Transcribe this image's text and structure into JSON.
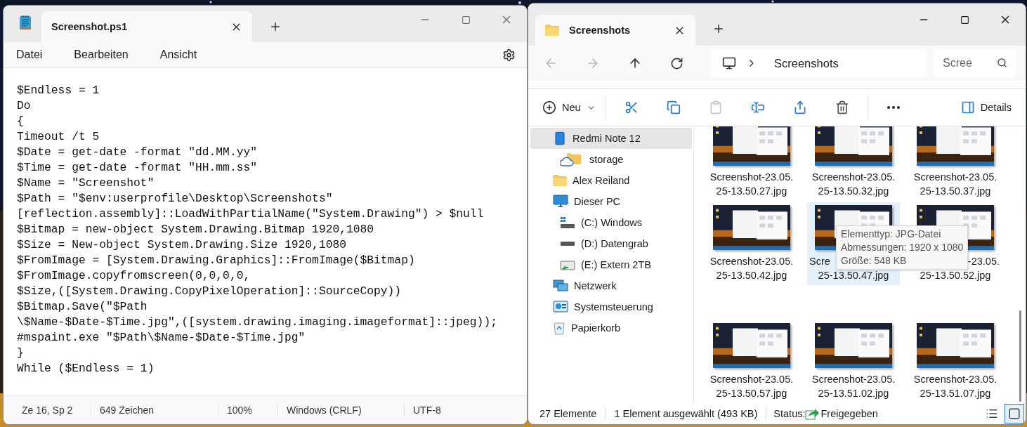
{
  "notepad": {
    "tab_title": "Screenshot.ps1",
    "menu": [
      "Datei",
      "Bearbeiten",
      "Ansicht"
    ],
    "code_lines": [
      "$Endless = 1",
      "Do",
      "{",
      "Timeout /t 5",
      "$Date = get-date -format \"dd.MM.yy\"",
      "$Time = get-date -format \"HH.mm.ss\"",
      "$Name = \"Screenshot\"",
      "$Path = \"$env:userprofile\\Desktop\\Screenshots\"",
      "[reflection.assembly]::LoadWithPartialName(\"System.Drawing\") > $null",
      "$Bitmap = new-object System.Drawing.Bitmap 1920,1080",
      "$Size = New-object System.Drawing.Size 1920,1080",
      "$FromImage = [System.Drawing.Graphics]::FromImage($Bitmap)",
      "$FromImage.copyfromscreen(0,0,0,0,",
      "$Size,([System.Drawing.CopyPixelOperation]::SourceCopy))",
      "$Bitmap.Save(\"$Path",
      "\\$Name-$Date-$Time.jpg\",([system.drawing.imaging.imageformat]::jpeg));",
      "#mspaint.exe \"$Path\\$Name-$Date-$Time.jpg\"",
      "}",
      "While ($Endless = 1)"
    ],
    "status": [
      "Ze 16, Sp 2",
      "649 Zeichen",
      "100%",
      "Windows (CRLF)",
      "UTF-8"
    ]
  },
  "explorer": {
    "tab_title": "Screenshots",
    "nav": [
      {
        "kind": "back",
        "disabled": true
      },
      {
        "kind": "forward",
        "disabled": true
      },
      {
        "kind": "up",
        "disabled": false
      },
      {
        "kind": "refresh",
        "disabled": false
      }
    ],
    "address": "Screenshots",
    "search": {
      "placeholder": "Scree"
    },
    "toolbar": [
      {
        "kind": "new",
        "label": "Neu",
        "disabled": false
      },
      {
        "kind": "cut",
        "disabled": false
      },
      {
        "kind": "copy",
        "disabled": false
      },
      {
        "kind": "paste",
        "disabled": true
      },
      {
        "kind": "rename",
        "disabled": false
      },
      {
        "kind": "share",
        "disabled": false
      },
      {
        "kind": "delete",
        "disabled": false
      },
      {
        "kind": "more",
        "disabled": false
      },
      {
        "kind": "details",
        "label": "Details",
        "disabled": false
      }
    ],
    "sidebar": [
      {
        "kind": "phone",
        "label": "Redmi Note 12",
        "selected": true,
        "children": [
          {
            "kind": "cloud-folder",
            "label": "storage",
            "selected": false
          }
        ]
      },
      {
        "kind": "folder",
        "label": "Alex Reiland",
        "selected": false
      },
      {
        "kind": "pc",
        "label": "Dieser PC",
        "selected": false,
        "children": [
          {
            "kind": "drive-windows",
            "label": "(C:) Windows",
            "selected": false
          },
          {
            "kind": "drive",
            "label": "(D:) Datengrab",
            "selected": false
          },
          {
            "kind": "drive-shared",
            "label": "(E:) Extern 2TB",
            "selected": false
          }
        ]
      },
      {
        "kind": "network",
        "label": "Netzwerk",
        "selected": false
      },
      {
        "kind": "control-panel",
        "label": "Systemsteuerung",
        "selected": false
      },
      {
        "kind": "recycle",
        "label": "Papierkorb",
        "selected": false
      }
    ],
    "files": [
      {
        "line_1": "Screenshot-23.05.",
        "line_2": "25-13.50.27.jpg",
        "selected": false
      },
      {
        "line_1": "Screenshot-23.05.",
        "line_2": "25-13.50.32.jpg",
        "selected": false
      },
      {
        "line_1": "Screenshot-23.05.",
        "line_2": "25-13.50.37.jpg",
        "selected": false
      },
      {
        "line_1": "Screenshot-23.05.",
        "line_2": "25-13.50.42.jpg",
        "selected": false
      },
      {
        "line_1": "Scre",
        "line_1_cut_end": true,
        "line_2": "25-13.50.47.jpg",
        "selected": true
      },
      {
        "line_1": "-23.05.",
        "line_1_cut_start": true,
        "line_2": "25-13.50.52.jpg",
        "selected": false
      },
      {
        "line_1": "Screenshot-23.05.",
        "line_2": "25-13.50.57.jpg",
        "selected": false
      },
      {
        "line_1": "Screenshot-23.05.",
        "line_2": "25-13.51.02.jpg",
        "selected": false
      },
      {
        "line_1": "Screenshot-23.05.",
        "line_2": "25-13.51.07.jpg",
        "selected": false
      }
    ],
    "tooltip": [
      "Elementtyp: JPG-Datei",
      "Abmessungen: 1920 x 1080",
      "Größe: 548 KB"
    ],
    "status": {
      "count": "27 Elemente",
      "selection": "1 Element ausgewählt (493 KB)",
      "status_label": "Status:",
      "status_value": "Freigegeben"
    },
    "views": [
      {
        "kind": "list",
        "selected": false
      },
      {
        "kind": "tiles",
        "selected": true
      }
    ]
  }
}
